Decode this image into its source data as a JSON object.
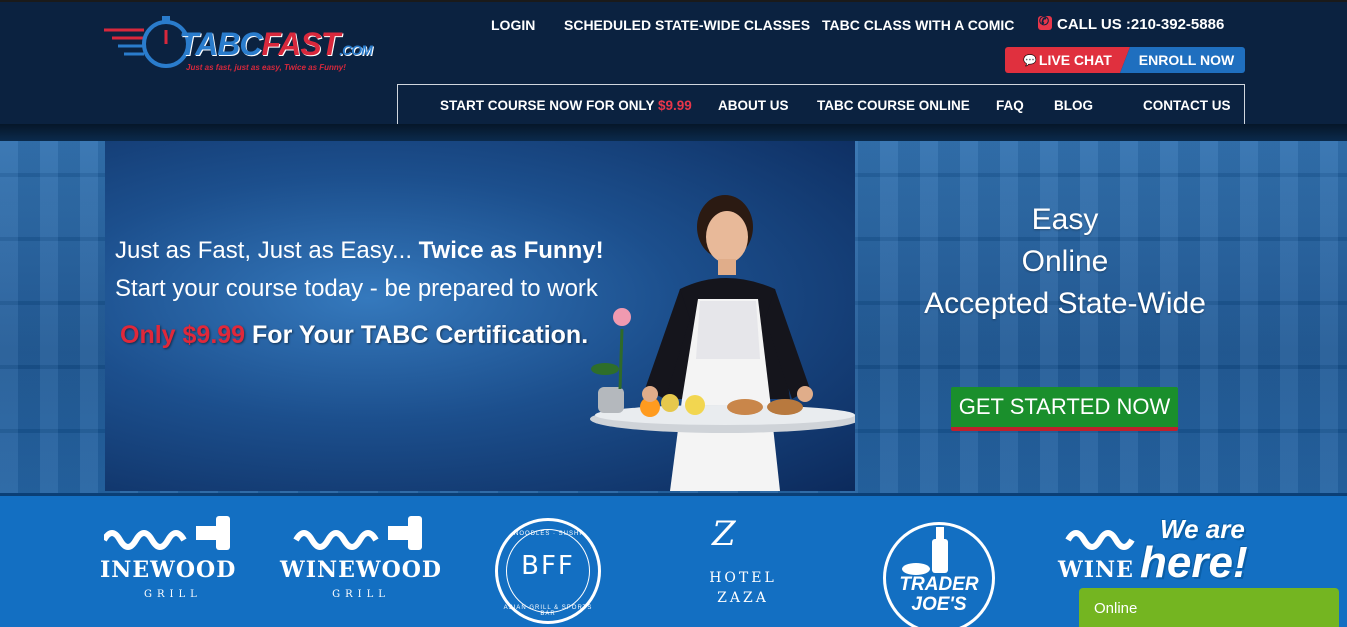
{
  "logo": {
    "brand_main": "TABC",
    "brand_accent": "FAST",
    "brand_suffix": ".COM",
    "tagline": "Just as fast, just as easy, Twice as Funny!"
  },
  "topnav": {
    "login": "LOGIN",
    "scheduled": "SCHEDULED STATE-WIDE CLASSES",
    "comic": "TABC CLASS WITH A COMIC",
    "call": "CALL US :210-392-5886"
  },
  "actions": {
    "live_chat": "LIVE CHAT",
    "enroll": "ENROLL NOW"
  },
  "mainnav": {
    "start_course": "START COURSE NOW FOR ONLY ",
    "start_price": "$9.99",
    "about": "ABOUT US",
    "online": "TABC COURSE ONLINE",
    "faq": "FAQ",
    "blog": "BLOG",
    "contact": "CONTACT US"
  },
  "hero": {
    "line1_a": "Just as Fast, Just as Easy... ",
    "line1_b": "Twice as Funny!",
    "line2": "Start your course today - be prepared to work",
    "line3_price": "Only $9.99",
    "line3_rest": " For Your TABC Certification.",
    "side_1": "Easy",
    "side_2": "Online",
    "side_3": "Accepted State-Wide",
    "cta": "GET STARTED NOW"
  },
  "partners": {
    "winewood_word_cropped": "INEWOOD",
    "winewood_word": "WINEWOOD",
    "winewood_sub": "GRILL",
    "bff_top": "NOODLES · SUSHI",
    "bff_main": "BFF",
    "bff_bottom": "ASIAN GRILL & SPORTS BAR",
    "zaza_line1": "HOTEL",
    "zaza_line2": "ZAZA",
    "tj_line1": "TRADER",
    "tj_line2": "JOE'S",
    "winewood_partial": "WINE"
  },
  "chat_widget": {
    "we_are": "We are",
    "here": "here!",
    "status": "Online"
  },
  "colors": {
    "header_bg": "#0b2240",
    "accent_red": "#e0303e",
    "accent_blue": "#1f6fbf",
    "cta_green": "#1a8f2c",
    "online_green": "#74b521",
    "strip_blue": "#136fc2"
  }
}
